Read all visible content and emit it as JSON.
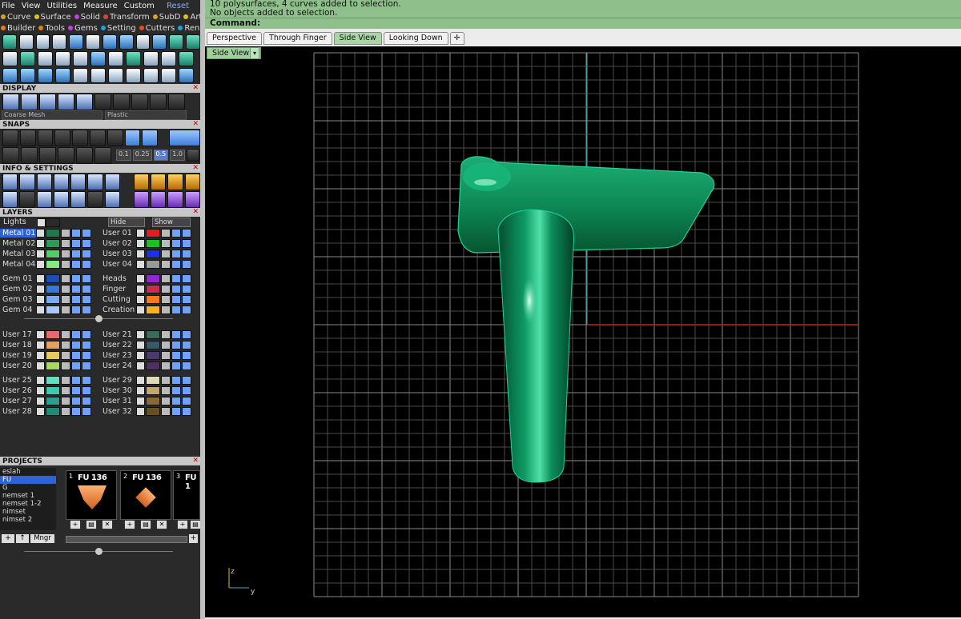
{
  "menu": {
    "items": [
      "File",
      "View",
      "Utilities",
      "Measure",
      "Custom"
    ],
    "reset": "Reset"
  },
  "categories_row1": [
    {
      "label": "Curve",
      "color": "#e0a020"
    },
    {
      "label": "Surface",
      "color": "#e0c020"
    },
    {
      "label": "Solid",
      "color": "#c040e0"
    },
    {
      "label": "Transform",
      "color": "#e04040"
    },
    {
      "label": "SubD",
      "color": "#e0a020"
    },
    {
      "label": "Art",
      "color": "#e0c020"
    }
  ],
  "categories_row2": [
    {
      "label": "Builder",
      "color": "#e08020"
    },
    {
      "label": "Tools",
      "color": "#e08020"
    },
    {
      "label": "Gems",
      "color": "#c040e0"
    },
    {
      "label": "Setting",
      "color": "#20a0e0"
    },
    {
      "label": "Cutters",
      "color": "#e05020"
    },
    {
      "label": "Render",
      "color": "#20a0e0"
    }
  ],
  "panels": {
    "display": "DISPLAY",
    "snaps": "SNAPS",
    "info": "INFO & SETTINGS",
    "layers": "LAYERS",
    "projects": "PROJECTS"
  },
  "display": {
    "mesh": "Coarse Mesh",
    "material": "Plastic"
  },
  "snaps": {
    "values": [
      "0.1",
      "0.25",
      "0.5",
      "1.0"
    ]
  },
  "layers": {
    "lights": "Lights",
    "hide": "Hide",
    "show": "Show",
    "left": [
      {
        "name": "Metal 01",
        "color": "#1e7a4a"
      },
      {
        "name": "Metal 02",
        "color": "#2f9a5a"
      },
      {
        "name": "Metal 03",
        "color": "#55cc66"
      },
      {
        "name": "Metal 04",
        "color": "#88e888"
      },
      {
        "name": "Gem 01",
        "color": "#1e4fb0"
      },
      {
        "name": "Gem 02",
        "color": "#3a78d8"
      },
      {
        "name": "Gem 03",
        "color": "#7aaaf0"
      },
      {
        "name": "Gem 04",
        "color": "#a9c8ff"
      },
      {
        "name": "User 17",
        "color": "#e86a6a"
      },
      {
        "name": "User 18",
        "color": "#e8a060"
      },
      {
        "name": "User 19",
        "color": "#e8c860"
      },
      {
        "name": "User 20",
        "color": "#a8d860"
      },
      {
        "name": "User 25",
        "color": "#60e0c0"
      },
      {
        "name": "User 26",
        "color": "#40c8b0"
      },
      {
        "name": "User 27",
        "color": "#2a9f8c"
      },
      {
        "name": "User 28",
        "color": "#1f8a78"
      }
    ],
    "right": [
      {
        "name": "User 01",
        "color": "#e02020"
      },
      {
        "name": "User 02",
        "color": "#20c020"
      },
      {
        "name": "User 03",
        "color": "#2030e0"
      },
      {
        "name": "User 04",
        "color": "#999999"
      },
      {
        "name": "Heads",
        "color": "#8a2ad0"
      },
      {
        "name": "Finger",
        "color": "#c03050"
      },
      {
        "name": "Cutting",
        "color": "#ff7a10"
      },
      {
        "name": "Creation",
        "color": "#ffb020"
      },
      {
        "name": "User 21",
        "color": "#3a6a58"
      },
      {
        "name": "User 22",
        "color": "#3a5868"
      },
      {
        "name": "User 23",
        "color": "#4a3a70"
      },
      {
        "name": "User 24",
        "color": "#503060"
      },
      {
        "name": "User 29",
        "color": "#e0d8b8"
      },
      {
        "name": "User 30",
        "color": "#c0a870"
      },
      {
        "name": "User 31",
        "color": "#8a6a30"
      },
      {
        "name": "User 32",
        "color": "#6a5020"
      }
    ]
  },
  "projects": {
    "list": [
      "eslah",
      "FU",
      "G",
      "nemset 1",
      "nemset 1-2",
      "nimset",
      "nimset 2"
    ],
    "selected": "FU",
    "thumbs": [
      {
        "num": "1",
        "label": "FU 136"
      },
      {
        "num": "2",
        "label": "FU 136"
      },
      {
        "num": "3",
        "label": "FU 1"
      }
    ],
    "mngr": "Mngr"
  },
  "status": {
    "line1": "10 polysurfaces, 4 curves added to selection.",
    "line2": "No objects added to selection.",
    "command": "Command:"
  },
  "tabs": [
    "Perspective",
    "Through Finger",
    "Side View",
    "Looking Down"
  ],
  "active_tab": "Side View",
  "viewport": {
    "label": "Side View",
    "axis_z": "z",
    "axis_y": "y"
  },
  "colors": {
    "model": "#0e8f5a",
    "grid": "#6e6e6e",
    "axis_red": "#c02020",
    "axis_cyan": "#2aa8b8",
    "status_bg": "#8fc08c"
  }
}
